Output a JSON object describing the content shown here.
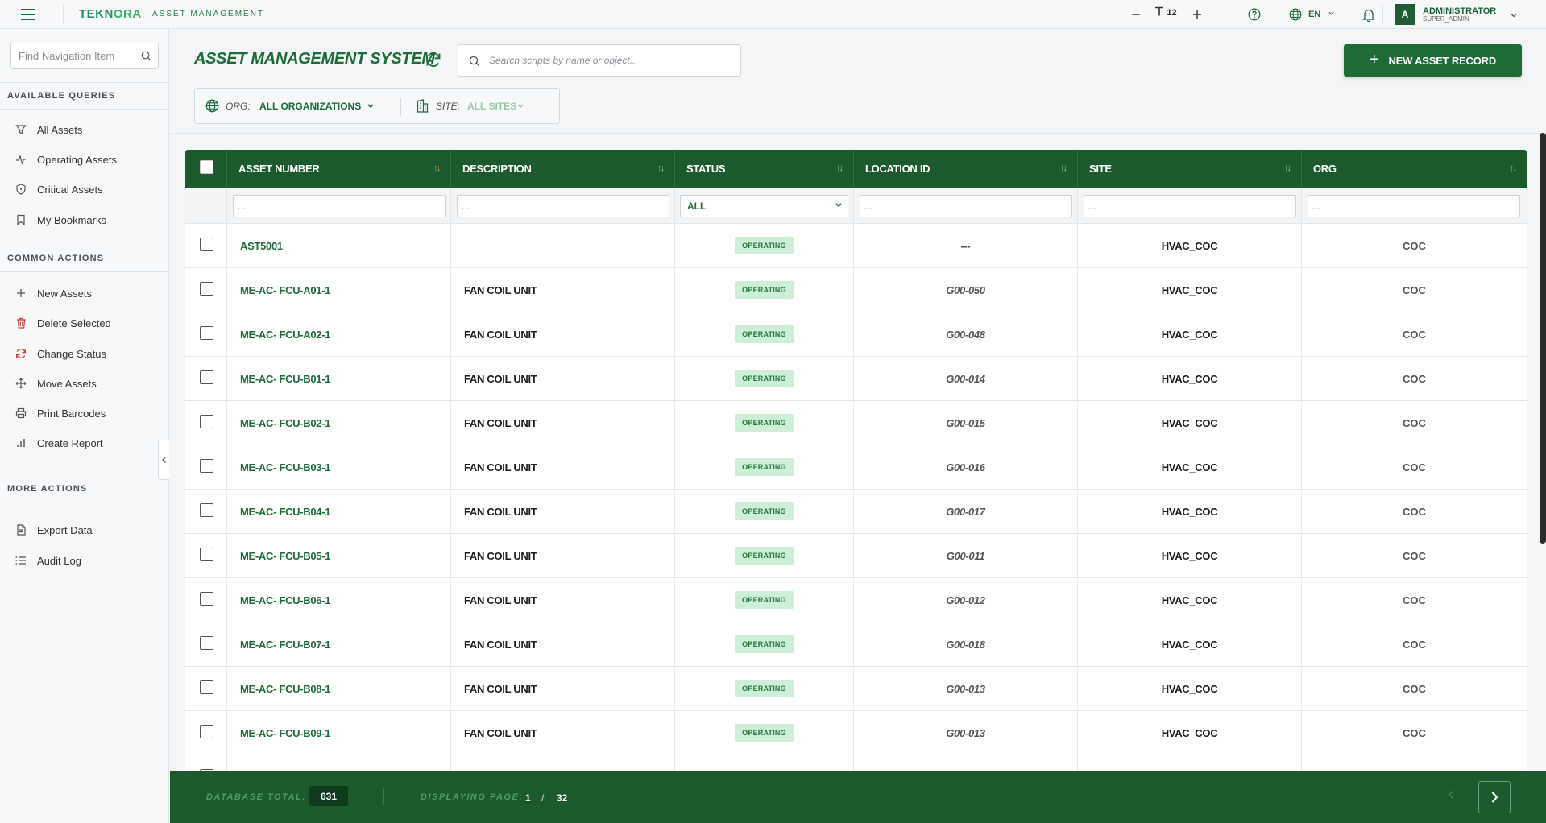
{
  "topbar": {
    "brand_part1": "TEKN",
    "brand_part2": "ORA",
    "brand_sub": "ASSET MANAGEMENT",
    "font_size_value": "12",
    "language": "EN",
    "user_name": "ADMINISTRATOR",
    "user_role": "SUPER_ADMIN",
    "user_initial": "A"
  },
  "sidebar": {
    "search_placeholder": "Find Navigation Item",
    "available_queries": "AVAILABLE QUERIES",
    "common_actions": "COMMON ACTIONS",
    "more_actions": "MORE ACTIONS",
    "queries": [
      {
        "label": "All Assets",
        "icon": "filter-icon"
      },
      {
        "label": "Operating Assets",
        "icon": "activity-icon"
      },
      {
        "label": "Critical Assets",
        "icon": "shield-icon"
      },
      {
        "label": "My Bookmarks",
        "icon": "bookmark-icon"
      }
    ],
    "actions": [
      {
        "label": "New Assets",
        "icon": "plus-icon"
      },
      {
        "label": "Delete Selected",
        "icon": "trash-icon"
      },
      {
        "label": "Change Status",
        "icon": "refresh-icon"
      },
      {
        "label": "Move Assets",
        "icon": "move-icon"
      },
      {
        "label": "Print Barcodes",
        "icon": "printer-icon"
      },
      {
        "label": "Create Report",
        "icon": "bar-chart-icon"
      }
    ],
    "more": [
      {
        "label": "Export Data",
        "icon": "file-icon"
      },
      {
        "label": "Audit Log",
        "icon": "list-icon"
      }
    ]
  },
  "main": {
    "title": "ASSET MANAGEMENT SYSTEM",
    "search_placeholder": "Search scripts by name or object...",
    "new_button": "NEW ASSET RECORD",
    "org_label": "ORG:",
    "org_value": "ALL ORGANIZATIONS",
    "site_label": "SITE:",
    "site_value": "ALL SITES"
  },
  "table": {
    "columns": [
      "ASSET NUMBER",
      "DESCRIPTION",
      "STATUS",
      "LOCATION ID",
      "SITE",
      "ORG"
    ],
    "filter_placeholder": "...",
    "status_filter": "ALL",
    "rows": [
      {
        "asset": "AST5001",
        "desc": "",
        "status": "OPERATING",
        "loc": "---",
        "site": "HVAC_COC",
        "org": "COC"
      },
      {
        "asset": "ME-AC- FCU-A01-1",
        "desc": "FAN COIL UNIT",
        "status": "OPERATING",
        "loc": "G00-050",
        "site": "HVAC_COC",
        "org": "COC"
      },
      {
        "asset": "ME-AC- FCU-A02-1",
        "desc": "FAN COIL UNIT",
        "status": "OPERATING",
        "loc": "G00-048",
        "site": "HVAC_COC",
        "org": "COC"
      },
      {
        "asset": "ME-AC- FCU-B01-1",
        "desc": "FAN COIL UNIT",
        "status": "OPERATING",
        "loc": "G00-014",
        "site": "HVAC_COC",
        "org": "COC"
      },
      {
        "asset": "ME-AC- FCU-B02-1",
        "desc": "FAN COIL UNIT",
        "status": "OPERATING",
        "loc": "G00-015",
        "site": "HVAC_COC",
        "org": "COC"
      },
      {
        "asset": "ME-AC- FCU-B03-1",
        "desc": "FAN COIL UNIT",
        "status": "OPERATING",
        "loc": "G00-016",
        "site": "HVAC_COC",
        "org": "COC"
      },
      {
        "asset": "ME-AC- FCU-B04-1",
        "desc": "FAN COIL UNIT",
        "status": "OPERATING",
        "loc": "G00-017",
        "site": "HVAC_COC",
        "org": "COC"
      },
      {
        "asset": "ME-AC- FCU-B05-1",
        "desc": "FAN COIL UNIT",
        "status": "OPERATING",
        "loc": "G00-011",
        "site": "HVAC_COC",
        "org": "COC"
      },
      {
        "asset": "ME-AC- FCU-B06-1",
        "desc": "FAN COIL UNIT",
        "status": "OPERATING",
        "loc": "G00-012",
        "site": "HVAC_COC",
        "org": "COC"
      },
      {
        "asset": "ME-AC- FCU-B07-1",
        "desc": "FAN COIL UNIT",
        "status": "OPERATING",
        "loc": "G00-018",
        "site": "HVAC_COC",
        "org": "COC"
      },
      {
        "asset": "ME-AC- FCU-B08-1",
        "desc": "FAN COIL UNIT",
        "status": "OPERATING",
        "loc": "G00-013",
        "site": "HVAC_COC",
        "org": "COC"
      },
      {
        "asset": "ME-AC- FCU-B09-1",
        "desc": "FAN COIL UNIT",
        "status": "OPERATING",
        "loc": "G00-013",
        "site": "HVAC_COC",
        "org": "COC"
      }
    ]
  },
  "footer": {
    "total_label": "DATABASE TOTAL:",
    "total_value": "631",
    "page_label": "DISPLAYING PAGE:",
    "current_page": "1",
    "page_separator": "/",
    "total_pages": "32"
  },
  "colors": {
    "brand_green": "#1e6b3a",
    "header_green": "#1c5a2e",
    "status_bg": "#cfeed8",
    "sort_active": "#e49a3a"
  }
}
